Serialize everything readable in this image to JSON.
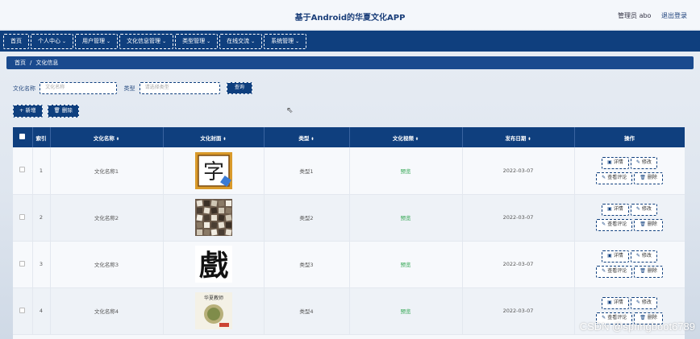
{
  "header": {
    "title": "基于Android的华夏文化APP",
    "user_label": "管理员 abo",
    "logout_label": "退出登录"
  },
  "nav": {
    "items": [
      {
        "label": "首页",
        "dropdown": false
      },
      {
        "label": "个人中心",
        "dropdown": true
      },
      {
        "label": "用户管理",
        "dropdown": true
      },
      {
        "label": "文化信息管理",
        "dropdown": true
      },
      {
        "label": "类型管理",
        "dropdown": true
      },
      {
        "label": "在线交流",
        "dropdown": true
      },
      {
        "label": "系统管理",
        "dropdown": true
      }
    ]
  },
  "breadcrumb": {
    "home": "首页",
    "separator": "/",
    "current": "文化信息"
  },
  "search": {
    "name_label": "文化名称",
    "name_placeholder": "文化名称",
    "type_label": "类型",
    "type_placeholder": "请选择类型",
    "button_label": "查询"
  },
  "actions": {
    "add_label": "+ 新增",
    "delete_label": "删除"
  },
  "table": {
    "columns": [
      "索引",
      "文化名称",
      "文化封面",
      "类型",
      "文化视频",
      "发布日期",
      "操作"
    ],
    "rows": [
      {
        "index": "1",
        "name": "文化名称1",
        "type": "类型1",
        "video": "预览",
        "date": "2022-03-07"
      },
      {
        "index": "2",
        "name": "文化名称2",
        "type": "类型2",
        "video": "预览",
        "date": "2022-03-07"
      },
      {
        "index": "3",
        "name": "文化名称3",
        "type": "类型3",
        "video": "预览",
        "date": "2022-03-07"
      },
      {
        "index": "4",
        "name": "文化名称4",
        "type": "类型4",
        "video": "预览",
        "date": "2022-03-07"
      }
    ],
    "row_ops": {
      "detail": "详情",
      "edit": "修改",
      "comments": "查看评论",
      "delete": "删除"
    },
    "cover_glyphs": [
      "字",
      "",
      "戲",
      "华夏教师"
    ]
  },
  "watermark": "CSDN @springboot6789",
  "colors": {
    "primary": "#0f3f7e",
    "video_link": "#2ea44f"
  }
}
